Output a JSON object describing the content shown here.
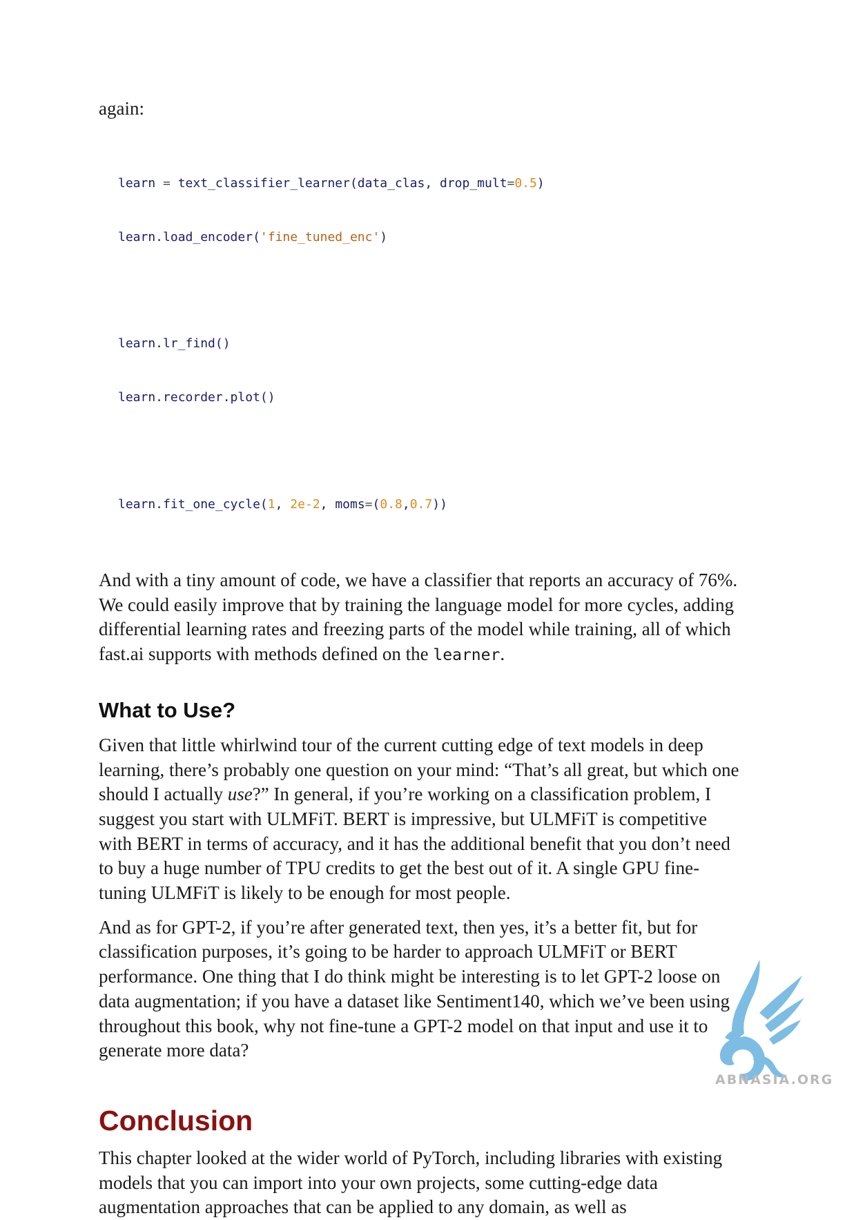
{
  "lead_text": "again:",
  "code_lines": {
    "line1": {
      "t1": "learn",
      "t2": " = ",
      "t3": "text_classifier_learner(data_clas, drop_mult",
      "t4": "=",
      "t5": "0.5",
      "t6": ")"
    },
    "line2": {
      "t1": "learn.load_encoder(",
      "t2": "'fine_tuned_enc'",
      "t3": ")"
    },
    "line3": "learn.lr_find()",
    "line4": "learn.recorder.plot()",
    "line5": {
      "t1": "learn.fit_one_cycle(",
      "t2": "1",
      "t3": ", ",
      "t4": "2e-2",
      "t5": ", moms",
      "t6": "=",
      "t7": "(",
      "t8": "0.8",
      "t9": ",",
      "t10": "0.7",
      "t11": "))"
    }
  },
  "paragraph1": {
    "text": "And with a tiny amount of code, we have a classifier that reports an accuracy of 76%. We could easily improve that by training the language model for more cycles, adding differential learning rates and freezing parts of the model while training, all of which fast.ai supports with methods defined on the ",
    "code": "learner",
    "end": "."
  },
  "section_heading": "What to Use?",
  "paragraph2": {
    "before": "Given that little whirlwind tour of the current cutting edge of text models in deep learning, there’s probably one question on your mind: “That’s all great, but which one should I actually ",
    "em": "use",
    "after": "?” In general, if you’re working on a classification problem, I suggest you start with ULMFiT. BERT is impressive, but ULMFiT is competitive with BERT in terms of accuracy, and it has the additional benefit that you don’t need to buy a huge number of TPU credits to get the best out of it. A single GPU fine-tuning ULMFiT is likely to be enough for most people."
  },
  "paragraph3": "And as for GPT-2, if you’re after generated text, then yes, it’s a better fit, but for classification purposes, it’s going to be harder to approach ULMFiT or BERT performance. One thing that I do think might be interesting is to let GPT-2 loose on data augmentation; if you have a dataset like Sentiment140, which we’ve been using throughout this book, why not fine-tune a GPT-2 model on that input and use it to generate more data?",
  "chapter_heading": "Conclusion",
  "paragraph4": "This chapter looked at the wider world of PyTorch, including libraries with existing models that you can import into your own projects, some cutting-edge data augmentation approaches that can be applied to any domain, as well as",
  "watermark": {
    "text": "ABNASIA.ORG",
    "icon": "griffin-logo-icon",
    "color": "#6fb6e0"
  }
}
